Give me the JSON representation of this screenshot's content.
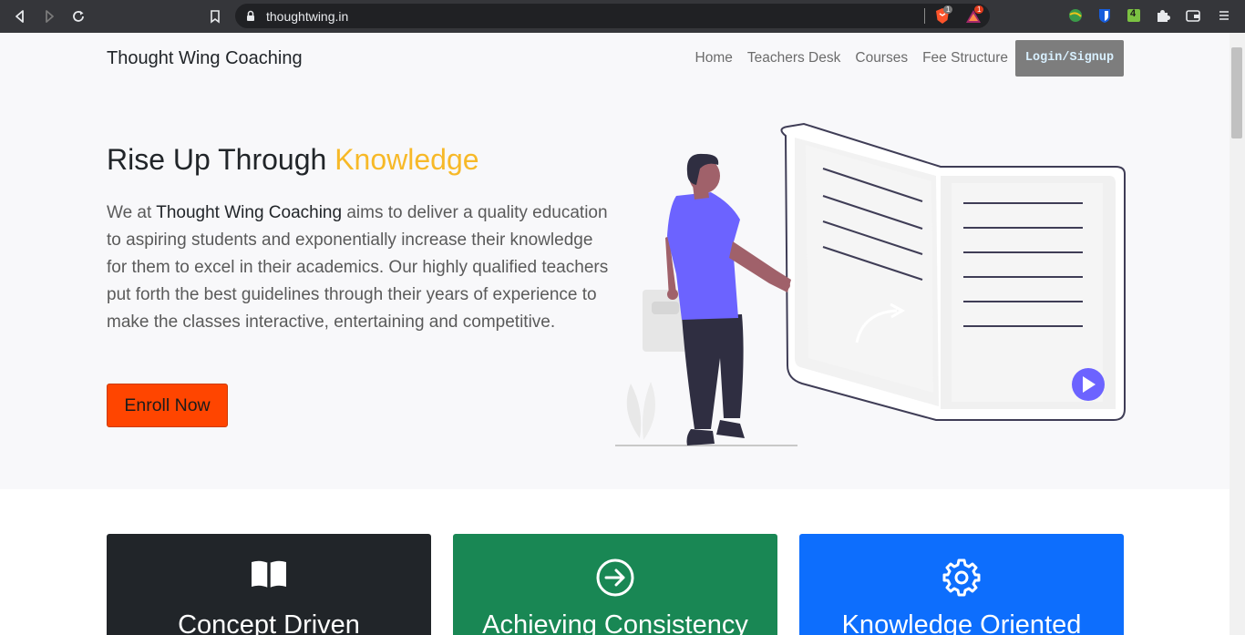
{
  "browser": {
    "url": "thoughtwing.in",
    "brave_badge": "1",
    "rewards_badge": "1",
    "ext_badge": "4"
  },
  "navbar": {
    "brand": "Thought Wing Coaching",
    "links": [
      "Home",
      "Teachers Desk",
      "Courses",
      "Fee Structure"
    ],
    "login_label": "Login/Signup"
  },
  "hero": {
    "headline_main": "Rise Up Through ",
    "headline_accent": "Knowledge",
    "lead_prefix": "We at ",
    "lead_strong": "Thought Wing Coaching",
    "lead_rest": " aims to deliver a quality education to aspiring students and exponentially increase their knowledge for them to excel in their academics. Our highly qualified teachers put forth the best guidelines through their years of experience to make the classes interactive, entertaining and competitive.",
    "cta": "Enroll Now"
  },
  "features": [
    {
      "title": "Concept Driven",
      "icon": "book-icon",
      "color": "#212529"
    },
    {
      "title": "Achieving Consistency",
      "icon": "arrow-circle-right-icon",
      "color": "#198754"
    },
    {
      "title": "Knowledge Oriented",
      "icon": "gear-icon",
      "color": "#0d6efd"
    }
  ],
  "colors": {
    "accent": "#f7b928",
    "cta": "#ff4500",
    "illustration_purple": "#6c63ff"
  }
}
